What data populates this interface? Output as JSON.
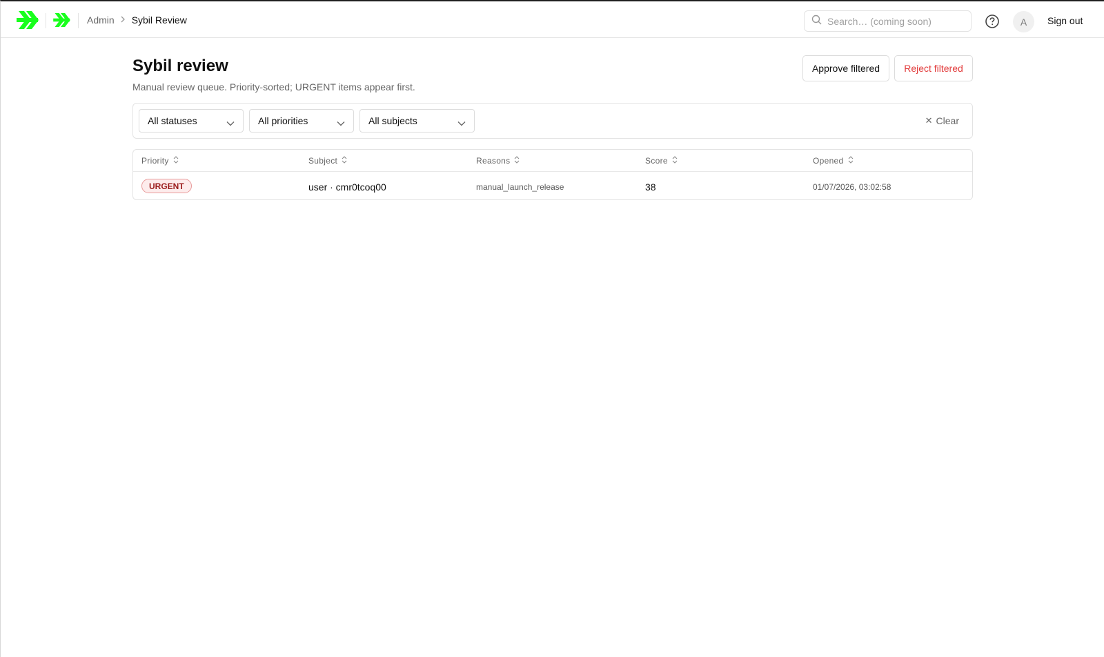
{
  "header": {
    "breadcrumb": {
      "parent": "Admin",
      "current": "Sybil Review"
    },
    "search": {
      "placeholder": "Search… (coming soon)"
    },
    "avatar_initial": "A",
    "sign_out_label": "Sign out"
  },
  "colors": {
    "brand": "#19ff1d",
    "danger": "#e23b3b",
    "urgent_badge_bg": "#fdecec",
    "urgent_badge_text": "#9b1c1c"
  },
  "page": {
    "title": "Sybil review",
    "subtitle": "Manual review queue. Priority-sorted; URGENT items appear first.",
    "approve_label": "Approve filtered",
    "reject_label": "Reject filtered"
  },
  "filters": {
    "status": "All statuses",
    "priority": "All priorities",
    "subject": "All subjects",
    "clear_label": "Clear"
  },
  "table": {
    "columns": [
      "Priority",
      "Subject",
      "Reasons",
      "Score",
      "Opened"
    ],
    "rows": [
      {
        "priority": "URGENT",
        "subject": "user · cmr0tcoq00",
        "reasons": "manual_launch_release",
        "score": "38",
        "opened": "01/07/2026, 03:02:58"
      }
    ]
  }
}
